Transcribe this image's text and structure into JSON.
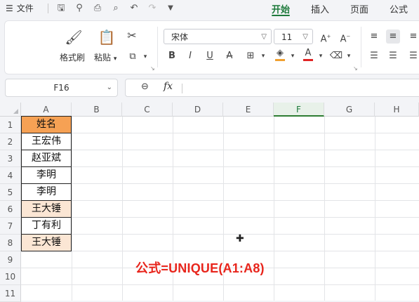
{
  "menubar": {
    "file_label": "文件",
    "tabs": [
      {
        "label": "开始",
        "active": true
      },
      {
        "label": "插入",
        "active": false
      },
      {
        "label": "页面",
        "active": false
      },
      {
        "label": "公式",
        "active": false
      }
    ],
    "accent_color": "#1e7a3c"
  },
  "ribbon": {
    "format_painter": "格式刷",
    "paste": "粘贴",
    "font_name": "宋体",
    "font_size": "11"
  },
  "formula_bar": {
    "name_box": "F16",
    "fx": "fx",
    "content": ""
  },
  "sheet": {
    "columns": [
      "A",
      "B",
      "C",
      "D",
      "E",
      "F",
      "G",
      "H"
    ],
    "selected_column": "F",
    "rows": [
      "1",
      "2",
      "3",
      "4",
      "5",
      "6",
      "7",
      "8",
      "9",
      "10",
      "11"
    ],
    "column_a": [
      {
        "row": 1,
        "text": "姓名",
        "style": "header"
      },
      {
        "row": 2,
        "text": "王宏伟",
        "style": "plain"
      },
      {
        "row": 3,
        "text": "赵亚斌",
        "style": "plain"
      },
      {
        "row": 4,
        "text": "李明",
        "style": "plain"
      },
      {
        "row": 5,
        "text": "李明",
        "style": "plain"
      },
      {
        "row": 6,
        "text": "王大锤",
        "style": "dup"
      },
      {
        "row": 7,
        "text": "丁有利",
        "style": "plain"
      },
      {
        "row": 8,
        "text": "王大锤",
        "style": "dup"
      }
    ],
    "header_fill": "#f6a154",
    "duplicate_fill": "#fbe6d4",
    "note": "公式=UNIQUE(A1:A8)",
    "note_color": "#e8251c"
  }
}
